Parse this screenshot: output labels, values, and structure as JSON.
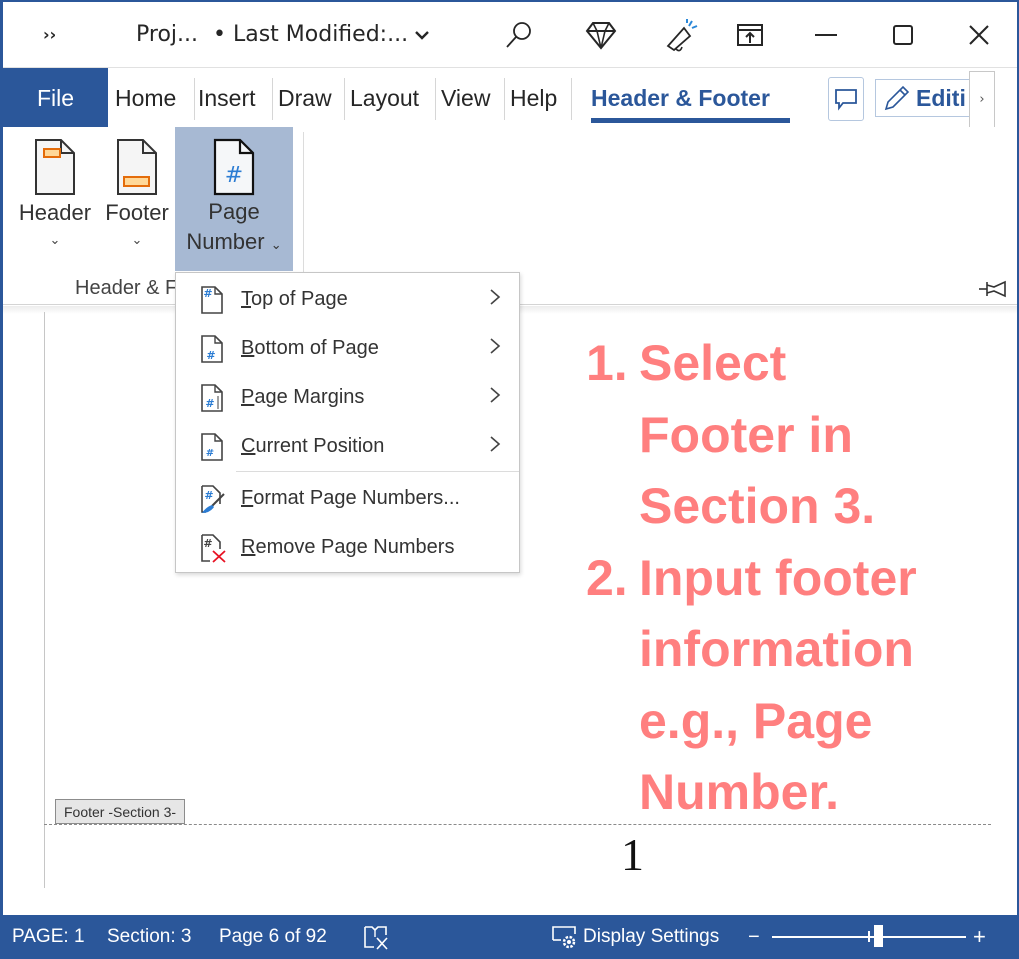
{
  "titlebar": {
    "qat_more": "››",
    "doc_title": "Proj...",
    "doc_modified": "• Last Modified:...",
    "icons": [
      "search-icon",
      "diamond-icon",
      "megaphone-icon",
      "ribbon-display-icon",
      "minimize-icon",
      "maximize-icon",
      "close-icon"
    ]
  },
  "tabs": {
    "file": "File",
    "items": [
      "Home",
      "Insert",
      "Draw",
      "Layout",
      "View",
      "Help"
    ],
    "active": "Header & Footer",
    "editing": "Editi",
    "scroll": "›"
  },
  "ribbon": {
    "header_label": "Header",
    "footer_label": "Footer",
    "page_number_label_1": "Page",
    "page_number_label_2": "Number",
    "chevron": "⌄",
    "group_label": "Header & F"
  },
  "menu": {
    "items": [
      {
        "accel": "T",
        "rest": "op of Page",
        "submenu": true
      },
      {
        "accel": "B",
        "rest": "ottom of Page",
        "submenu": true
      },
      {
        "accel": "P",
        "rest": "age Margins",
        "submenu": true
      },
      {
        "accel": "C",
        "rest": "urrent Position",
        "submenu": true
      },
      {
        "accel": "F",
        "rest": "ormat Page Numbers...",
        "submenu": false
      },
      {
        "accel": "R",
        "rest": "emove Page Numbers",
        "submenu": false
      }
    ],
    "arrow": "›"
  },
  "document": {
    "footer_tag": "Footer -Section 3-",
    "page_number_value": "1"
  },
  "annotation": {
    "lines": [
      {
        "num": "1.",
        "text": "Select"
      },
      {
        "num": "",
        "text": "Footer in"
      },
      {
        "num": "",
        "text": "Section 3."
      },
      {
        "num": "2.",
        "text": "Input footer"
      },
      {
        "num": "",
        "text": "information"
      },
      {
        "num": "",
        "text": "e.g., Page"
      },
      {
        "num": "",
        "text": "Number."
      }
    ],
    "color": "#ff7f7f"
  },
  "statusbar": {
    "page": "PAGE: 1",
    "section": "Section: 3",
    "page_of": "Page 6 of 92",
    "display_settings": "Display Settings",
    "zoom_minus": "−",
    "zoom_plus": "+",
    "zoom_level_fraction": 0.55
  },
  "colors": {
    "brand": "#2b579a",
    "selected_button": "#a7b9d3",
    "icon_orange": "#e46c0a",
    "icon_blue": "#2b7cd3"
  }
}
